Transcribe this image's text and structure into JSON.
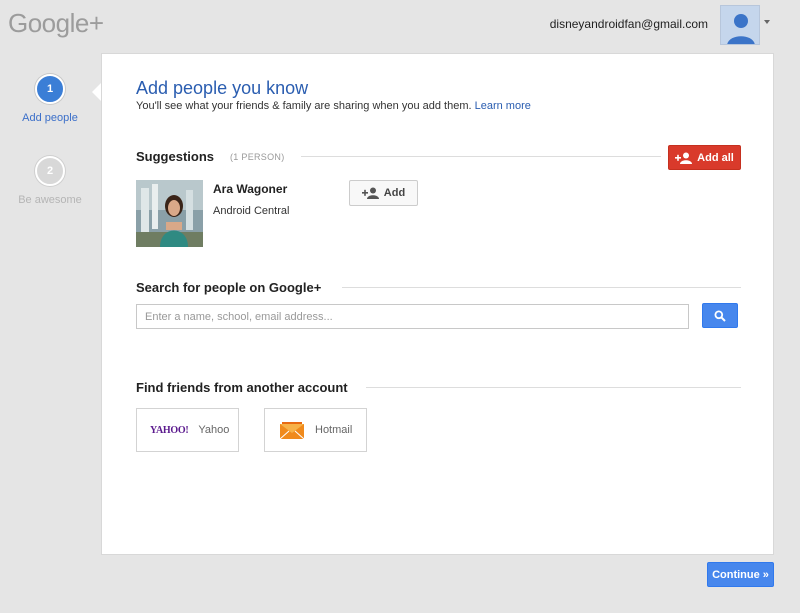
{
  "header": {
    "logo": "Google+",
    "account_email": "disneyandroidfan@gmail.com"
  },
  "steps": [
    {
      "number": "1",
      "label": "Add people"
    },
    {
      "number": "2",
      "label": "Be awesome"
    }
  ],
  "main": {
    "title": "Add people you know",
    "subtitle": "You'll see what your friends & family are sharing when you add them.",
    "learn_more": "Learn more",
    "suggestions": {
      "heading": "Suggestions",
      "count": "(1 PERSON)",
      "add_all_label": "Add all",
      "people": [
        {
          "name": "Ara Wagoner",
          "subtitle": "Android Central",
          "add_label": "Add"
        }
      ]
    },
    "search": {
      "heading": "Search for people on Google+",
      "placeholder": "Enter a name, school, email address..."
    },
    "find_friends": {
      "heading": "Find friends from another account",
      "accounts": [
        {
          "logo_text": "YAHOO!",
          "label": "Yahoo"
        },
        {
          "label": "Hotmail"
        }
      ]
    }
  },
  "footer": {
    "continue_label": "Continue »"
  },
  "colors": {
    "primary_blue": "#4787ed",
    "title_blue": "#2a5db0",
    "add_all_red": "#d93a2b"
  }
}
